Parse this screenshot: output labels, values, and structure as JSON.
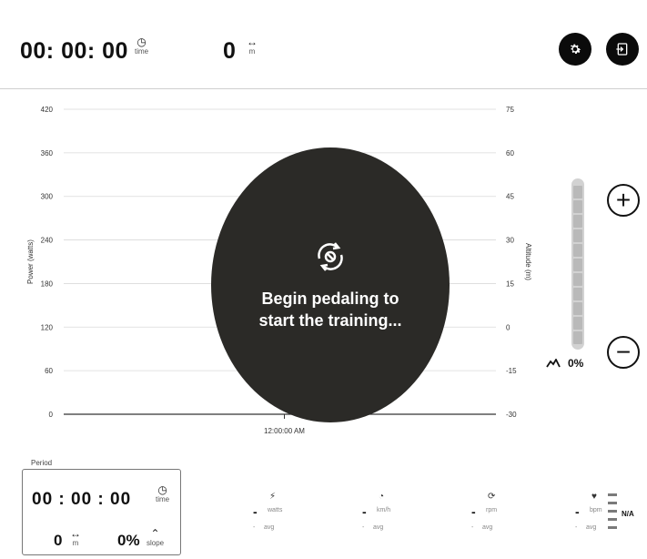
{
  "header": {
    "elapsed_time": "00: 00: 00",
    "time_label": "time",
    "distance": "0",
    "distance_unit": "m"
  },
  "chart_data": {
    "type": "line",
    "left_axis": {
      "label": "Power (watts)",
      "ticks": [
        0,
        60,
        120,
        180,
        240,
        300,
        360,
        420
      ],
      "range": [
        0,
        420
      ]
    },
    "right_axis": {
      "label": "Altitude (m)",
      "ticks": [
        -30,
        -15,
        0,
        15,
        30,
        45,
        60,
        75
      ],
      "range": [
        -30,
        75
      ]
    },
    "x_tick_labels": [
      "12:00:00 AM"
    ],
    "series": [],
    "grid": true
  },
  "overlay": {
    "message_line1": "Begin pedaling to",
    "message_line2": "start the training..."
  },
  "slope_control": {
    "plus_label": "+",
    "minus_label": "−",
    "value": "0%",
    "level_fraction": 0
  },
  "period": {
    "label": "Period",
    "time": "00 : 00 : 00",
    "time_label": "time",
    "distance": "0",
    "distance_unit": "m",
    "slope": "0%",
    "slope_label": "slope"
  },
  "metrics": [
    {
      "value": "-",
      "unit": "watts",
      "avg_value": "-",
      "avg_label": "avg",
      "icon": "lightning-icon"
    },
    {
      "value": "-",
      "unit": "km/h",
      "avg_value": "-",
      "avg_label": "avg",
      "icon": "speedometer-icon"
    },
    {
      "value": "-",
      "unit": "rpm",
      "avg_value": "-",
      "avg_label": "avg",
      "icon": "cadence-icon"
    },
    {
      "value": "-",
      "unit": "bpm",
      "avg_value": "-",
      "avg_label": "avg",
      "icon": "heart-icon"
    }
  ],
  "heart_zone": "N/A",
  "colors": {
    "overlay": "#2b2a27",
    "button_dark": "#0b0b0b",
    "gridline": "#d9d9d9",
    "slope_track": "#d2d2d2"
  }
}
